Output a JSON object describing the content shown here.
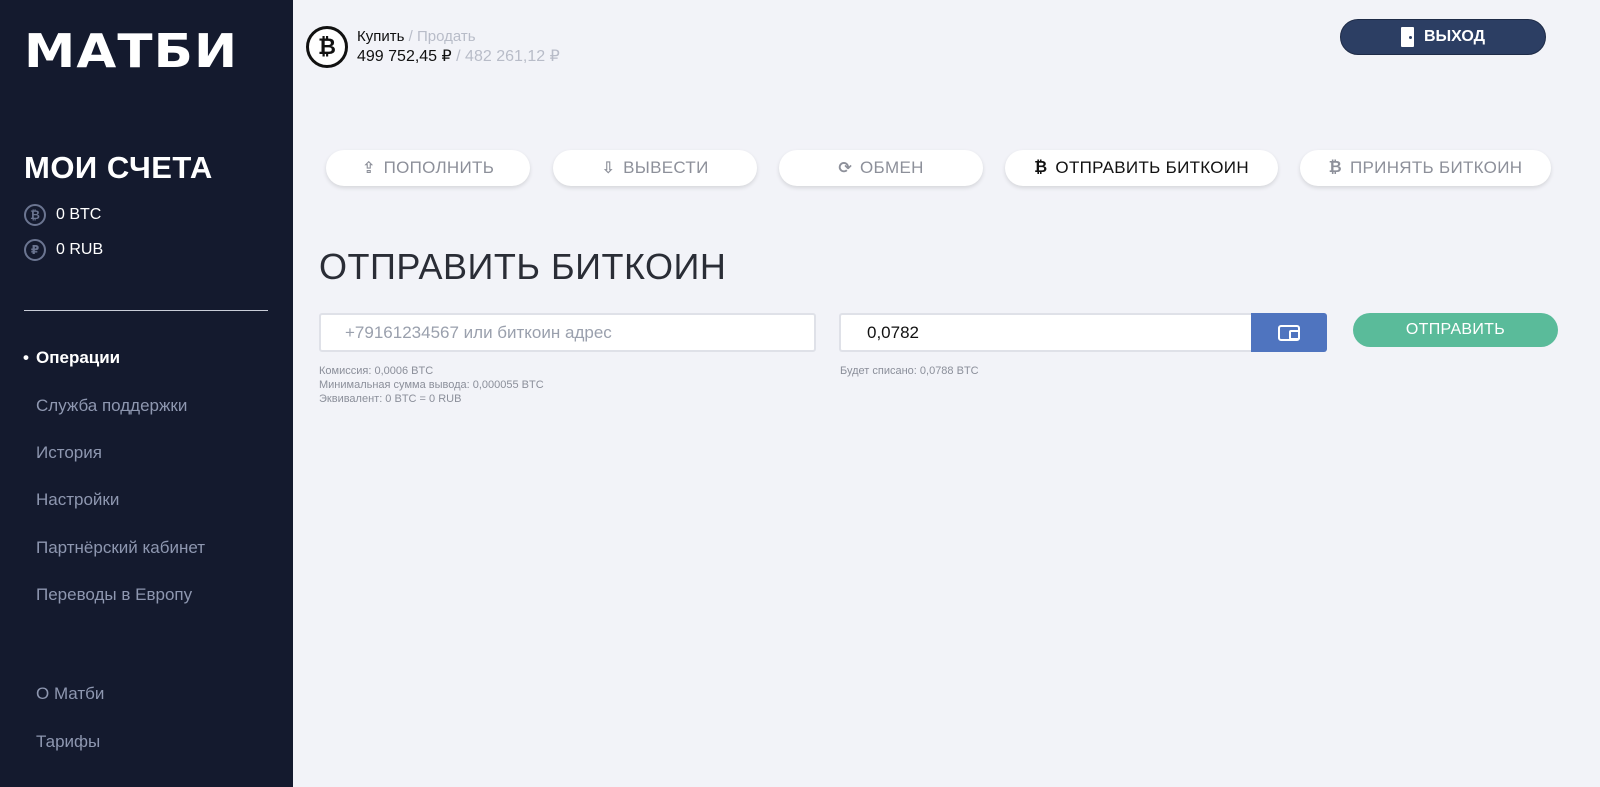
{
  "sidebar": {
    "logo": "МАТБИ",
    "accounts_title": "МОИ СЧЕТА",
    "accounts": [
      {
        "symbol": "₿",
        "label": "0 BTC"
      },
      {
        "symbol": "₽",
        "label": "0 RUB"
      }
    ],
    "nav": [
      {
        "label": "Операции",
        "active": true
      },
      {
        "label": "Служба поддержки"
      },
      {
        "label": "История"
      },
      {
        "label": "Настройки"
      },
      {
        "label": "Партнёрский кабинет"
      },
      {
        "label": "Переводы в Европу"
      },
      {
        "label": "О Матби"
      },
      {
        "label": "Тарифы"
      }
    ]
  },
  "header": {
    "btc_symbol": "₿",
    "buy_label": "Купить",
    "separator": " / ",
    "sell_label": "Продать",
    "buy_value": "499 752,45 ₽",
    "sell_value": "482 261,12 ₽",
    "logout_label": "ВЫХОД"
  },
  "tabs": [
    {
      "icon": "⇪",
      "label": "ПОПОЛНИТЬ"
    },
    {
      "icon": "⇩",
      "label": "ВЫВЕСТИ"
    },
    {
      "icon": "⟳",
      "label": "ОБМЕН"
    },
    {
      "icon": "₿",
      "label": "ОТПРАВИТЬ БИТКОИН",
      "active": true
    },
    {
      "icon": "₿",
      "label": "ПРИНЯТЬ БИТКОИН"
    }
  ],
  "form": {
    "title": "ОТПРАВИТЬ БИТКОИН",
    "address_placeholder": "+79161234567 или биткоин адрес",
    "address_value": "",
    "amount_value": "0,0782",
    "send_label": "ОТПРАВИТЬ",
    "hints_left": [
      "Комиссия: 0,0006 BTC",
      "Минимальная сумма вывода: 0,000055 BTC",
      "Эквивалент: 0 BTC = 0 RUB"
    ],
    "hint_right": "Будет списано: 0,0788 BTC"
  },
  "colors": {
    "sidebar_bg": "#141a2e",
    "page_bg": "#f2f3f8",
    "logout_bg": "#2c3e63",
    "wallet_bg": "#4f74bf",
    "send_bg": "#5abb9a"
  }
}
